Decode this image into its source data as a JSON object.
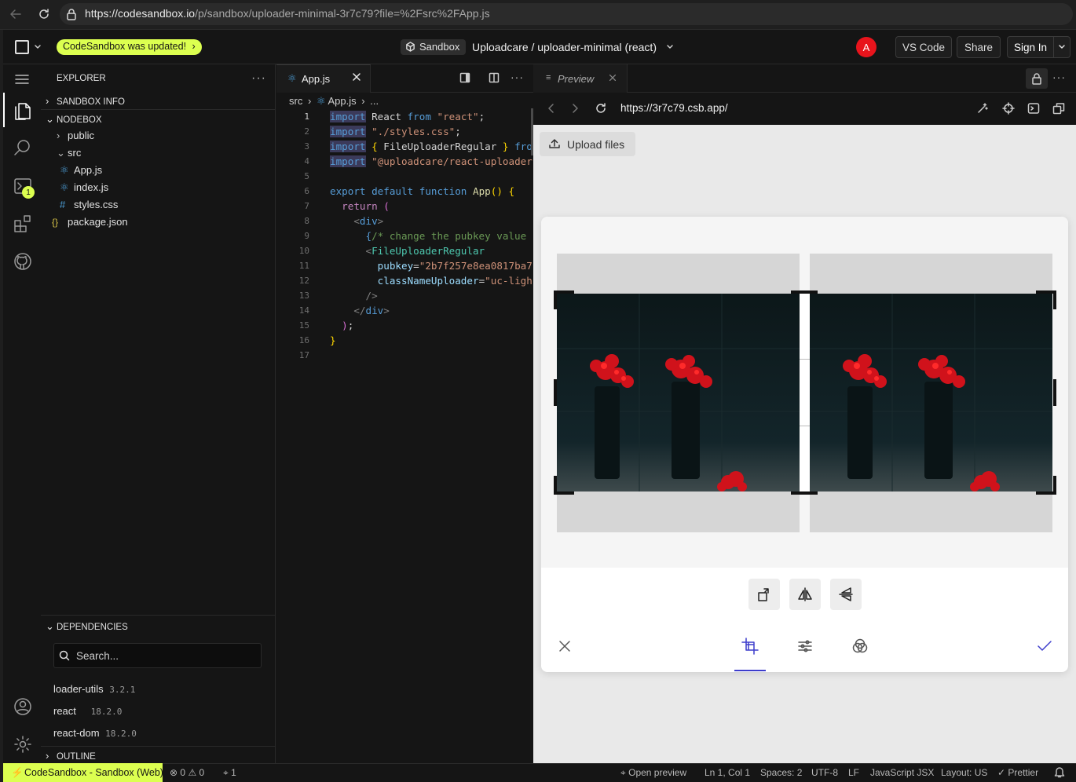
{
  "browser": {
    "url_host": "https://codesandbox.io",
    "url_path": "/p/sandbox/uploader-minimal-3r7c79?file=%2Fsrc%2FApp.js"
  },
  "topbar": {
    "update_badge": "CodeSandbox was updated!",
    "sandbox_chip": "Sandbox",
    "project_title": "Uploadcare / uploader-minimal (react)",
    "avatar_letter": "A",
    "vscode_label": "VS Code",
    "share_label": "Share",
    "signin_label": "Sign In"
  },
  "activity": {
    "terminal_badge": "1"
  },
  "explorer": {
    "title": "EXPLORER",
    "sandbox_info": "SANDBOX INFO",
    "nodebox": "NODEBOX",
    "tree": [
      {
        "label": "public",
        "type": "folder"
      },
      {
        "label": "src",
        "type": "folder-open"
      },
      {
        "label": "App.js",
        "type": "react"
      },
      {
        "label": "index.js",
        "type": "react"
      },
      {
        "label": "styles.css",
        "type": "css"
      },
      {
        "label": "package.json",
        "type": "json"
      }
    ],
    "dependencies_title": "DEPENDENCIES",
    "search_placeholder": "Search...",
    "dependencies": [
      {
        "name": "loader-utils",
        "version": "3.2.1"
      },
      {
        "name": "react",
        "version": "18.2.0"
      },
      {
        "name": "react-dom",
        "version": "18.2.0"
      }
    ],
    "outline_title": "OUTLINE"
  },
  "editor": {
    "tab_label": "App.js",
    "breadcrumb": {
      "folder": "src",
      "file": "App.js",
      "more": "..."
    },
    "line_numbers": [
      "1",
      "2",
      "3",
      "4",
      "5",
      "6",
      "7",
      "8",
      "9",
      "10",
      "11",
      "12",
      "13",
      "14",
      "15",
      "16",
      "17"
    ]
  },
  "preview": {
    "tab_label": "Preview",
    "address": "https://3r7c79.csb.app/",
    "upload_button": "Upload files"
  },
  "status": {
    "remote": "CodeSandbox - Sandbox (Web)",
    "errors": "0",
    "warnings": "0",
    "ports": "1",
    "open_preview": "Open preview",
    "cursor": "Ln 1, Col 1",
    "spaces": "Spaces: 2",
    "encoding": "UTF-8",
    "eol": "LF",
    "language": "JavaScript JSX",
    "layout": "Layout: US",
    "prettier": "Prettier"
  },
  "colors": {
    "accent_lime": "#dcff50",
    "avatar_red": "#e8141c",
    "uploader_blue": "#3d3dcc",
    "keyword": "#569cd6",
    "string": "#ce9178",
    "function": "#dcdcaa"
  }
}
